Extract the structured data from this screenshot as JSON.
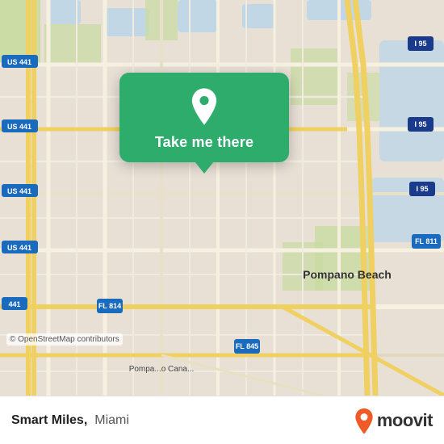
{
  "map": {
    "copyright": "© OpenStreetMap contributors",
    "alt": "Map of Pompano Beach Miami area"
  },
  "popup": {
    "label": "Take me there",
    "pin_icon": "location-pin-icon"
  },
  "bottom_bar": {
    "app_name": "Smart Miles,",
    "app_city": "Miami",
    "logo_text": "moovit"
  }
}
